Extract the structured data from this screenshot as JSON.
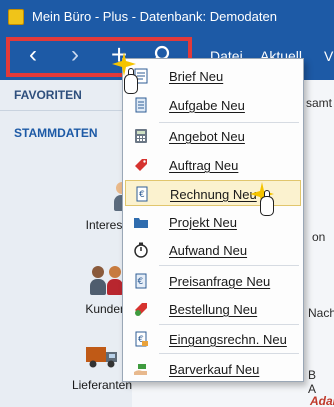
{
  "window": {
    "title": "Mein Büro - Plus - Datenbank: Demodaten"
  },
  "toolbar": {
    "prev_icon": "‹",
    "next_icon": "›",
    "add_icon": "+",
    "search_icon": "⌕"
  },
  "menubar": {
    "items": [
      "Datei",
      "Aktuell",
      "V"
    ]
  },
  "sidebar": {
    "favoriten": "FAVORITEN",
    "stammdaten": "STAMMDATEN",
    "entities": [
      "Interessenten",
      "Kunden",
      "Lieferanten"
    ]
  },
  "background_fragments": {
    "samt": "samt",
    "on": "on",
    "nachr": "Nachr",
    "abc": "B A",
    "adam": "Adam"
  },
  "new_menu": {
    "items": [
      {
        "label": "Brief Neu",
        "icon": "letter-icon"
      },
      {
        "label": "Aufgabe Neu",
        "icon": "task-icon"
      },
      {
        "label": "Angebot Neu",
        "icon": "calculator-icon"
      },
      {
        "label": "Auftrag Neu",
        "icon": "tag-icon"
      },
      {
        "label": "Rechnung Neu",
        "icon": "invoice-icon"
      },
      {
        "label": "Projekt Neu",
        "icon": "folder-icon"
      },
      {
        "label": "Aufwand Neu",
        "icon": "timer-icon"
      },
      {
        "label": "Preisanfrage Neu",
        "icon": "price-request-icon"
      },
      {
        "label": "Bestellung Neu",
        "icon": "order-icon"
      },
      {
        "label": "Eingangsrechn. Neu",
        "icon": "incoming-invoice-icon"
      },
      {
        "label": "Barverkauf Neu",
        "icon": "cash-sale-icon"
      }
    ],
    "active_item": "Rechnung Neu"
  },
  "colors": {
    "titlebar": "#1d5aa6",
    "highlight_frame": "#e23a3a",
    "menu_hover": "#fbf2cf"
  }
}
